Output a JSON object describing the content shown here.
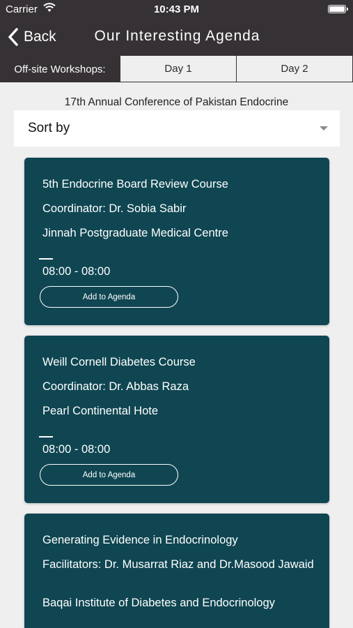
{
  "status": {
    "carrier": "Carrier",
    "time": "10:43 PM"
  },
  "nav": {
    "back_label": "Back",
    "title": "Our Interesting Agenda"
  },
  "tabs": {
    "label": "Off-site Workshops:",
    "items": [
      "Day 1",
      "Day 2"
    ]
  },
  "conference_title": "17th Annual Conference of Pakistan Endocrine",
  "sort": {
    "label": "Sort by"
  },
  "cards": [
    {
      "title": "5th Endocrine Board Review Course",
      "person": "Coordinator: Dr. Sobia Sabir",
      "venue": "Jinnah Postgraduate Medical Centre",
      "time": "08:00 - 08:00",
      "button": "Add to Agenda"
    },
    {
      "title": "Weill Cornell Diabetes Course",
      "person": "Coordinator: Dr. Abbas Raza",
      "venue": "Pearl Continental Hote",
      "time": "08:00 - 08:00",
      "button": "Add to Agenda"
    },
    {
      "title": "Generating Evidence in Endocrinology",
      "person": "Facilitators: Dr. Musarrat Riaz and Dr.Masood Jawaid",
      "venue": "Baqai Institute of Diabetes and Endocrinology"
    }
  ],
  "colors": {
    "header": "#363134",
    "card": "#0f4652",
    "background": "#efeff0"
  }
}
